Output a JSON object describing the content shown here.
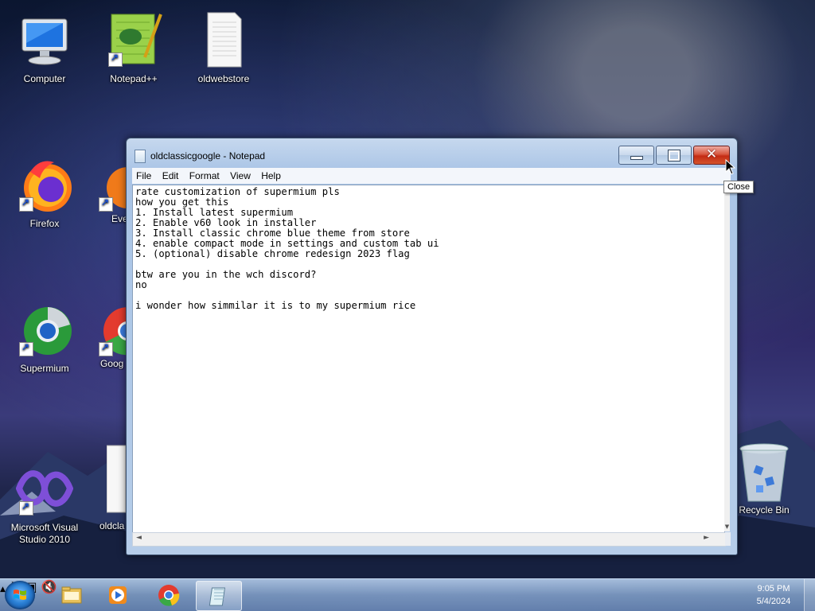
{
  "desktop": {
    "icons": [
      {
        "label": "Computer"
      },
      {
        "label": "Notepad++"
      },
      {
        "label": "oldwebstore"
      },
      {
        "label": "Firefox"
      },
      {
        "label": "Eve"
      },
      {
        "label": "Supermium"
      },
      {
        "label": "Goog"
      },
      {
        "label": "Microsoft Visual Studio 2010"
      },
      {
        "label": "oldcla"
      },
      {
        "label": "Recycle Bin"
      }
    ]
  },
  "window": {
    "title": "oldclassicgoogle - Notepad",
    "menu": [
      "File",
      "Edit",
      "Format",
      "View",
      "Help"
    ],
    "lines": [
      "rate customization of supermium pls",
      "how you get this",
      "1. Install latest supermium",
      "2. Enable v60 look in installer",
      "3. Install classic chrome blue theme from store",
      "4. enable compact mode in settings and custom tab ui",
      "5. (optional) disable chrome redesign 2023 flag",
      "",
      "btw are you in the wch discord?",
      "no",
      "",
      "i wonder how simmilar it is to my supermium rice"
    ]
  },
  "tooltip": {
    "text": "Close"
  },
  "taskbar": {
    "apps": [
      "explorer-icon",
      "media-player-icon",
      "chrome-icon",
      "notepad-icon"
    ],
    "clock": {
      "time": "9:05 PM",
      "date": "5/4/2024"
    }
  }
}
